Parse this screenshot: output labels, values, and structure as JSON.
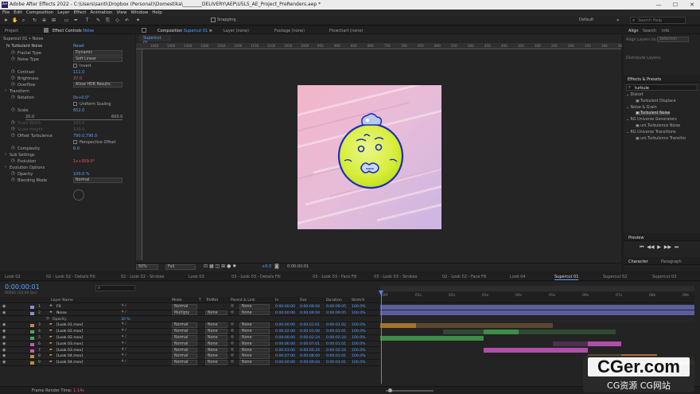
{
  "window": {
    "title": "Adobe After Effects 2022 - C:\\Users\\santi\\Dropbox (Personal)\\Domestika\\________DELIVERY\\AEP\\U5L5_AE_Project_PreRenders.aep *",
    "logo": "Ae",
    "min": "—",
    "max": "☐",
    "close": "✕"
  },
  "menu": [
    "File",
    "Edit",
    "Composition",
    "Layer",
    "Effect",
    "Animation",
    "View",
    "Window",
    "Help"
  ],
  "toolbar": {
    "snapping": "Snapping",
    "workspace": "Default",
    "workspace_more": "»",
    "search_placeholder": "Search Help"
  },
  "project_tab": "Project",
  "effect_controls_tab": "Effect Controls",
  "effect_controls_layer": "Noise",
  "effect_header": "Supercut 01 • Noise",
  "effect": {
    "name": "Turbulent Noise",
    "reset": "Reset",
    "fx": "fx",
    "props": [
      {
        "label": "Fractal Type",
        "value": "Dynamic",
        "kind": "dd"
      },
      {
        "label": "Noise Type",
        "value": "Soft Linear",
        "kind": "dd"
      },
      {
        "label": "",
        "value": "Invert",
        "kind": "cb"
      },
      {
        "label": "Contrast",
        "value": "111.0",
        "kind": "num"
      },
      {
        "label": "Brightness",
        "value": "37.0",
        "kind": "num",
        "red": true
      },
      {
        "label": "Overflow",
        "value": "Allow HDR Results",
        "kind": "dd"
      },
      {
        "label": "Transform",
        "value": "",
        "kind": "group"
      },
      {
        "label": "Rotation",
        "value": "0x+0.0°",
        "kind": "num"
      },
      {
        "label": "",
        "value": "Uniform Scaling",
        "kind": "cb"
      },
      {
        "label": "Scale",
        "value": "652.0",
        "kind": "num"
      },
      {
        "label": "",
        "value": "20.0",
        "kind": "slider",
        "max": "600.0"
      },
      {
        "label": "Scale Width",
        "value": "100.0",
        "kind": "num",
        "dim": true
      },
      {
        "label": "Scale Height",
        "value": "100.0",
        "kind": "num",
        "dim": true
      },
      {
        "label": "Offset Turbulence",
        "value": "790.0,790.0",
        "kind": "num"
      },
      {
        "label": "",
        "value": "Perspective Offset",
        "kind": "cb"
      },
      {
        "label": "Complexity",
        "value": "6.0",
        "kind": "num"
      },
      {
        "label": "Sub Settings",
        "value": "",
        "kind": "group"
      },
      {
        "label": "Evolution",
        "value": "1x+309.0°",
        "kind": "num",
        "red": true
      },
      {
        "label": "Evolution Options",
        "value": "",
        "kind": "group"
      },
      {
        "label": "Opacity",
        "value": "100.0 %",
        "kind": "num"
      },
      {
        "label": "Blending Mode",
        "value": "Normal",
        "kind": "dd"
      }
    ]
  },
  "comp": {
    "tab_prefix": "Composition",
    "tab_name": "Supercut 01",
    "menu_icon": "≡",
    "tab2": "Layer (none)",
    "tab3": "Footage (none)",
    "tab4": "Flowchart (none)",
    "crumb": "Supercut 01",
    "ruler": [
      "1450",
      "1400",
      "1350",
      "1300",
      "1250",
      "1200",
      "1150",
      "1100",
      "1050",
      "1000",
      "950",
      "900",
      "850",
      "800",
      "750",
      "700",
      "650",
      "600",
      "550",
      "500",
      "450",
      "400",
      "350",
      "300",
      "250",
      "200",
      "150",
      "100",
      "50"
    ],
    "zoom": "50%",
    "resolution": "Full",
    "exposure": "+0.0",
    "timecode": "0:00:00:01"
  },
  "right": {
    "align_tab": "Align",
    "search_tab": "Search",
    "info_tab": "Info",
    "align_to": "Align Layers to:",
    "align_to_value": "Selection",
    "distribute": "Distribute Layers:",
    "effects_tab": "Effects & Presets",
    "search_value": "turbule",
    "tree": [
      {
        "text": "Distort",
        "indent": 0
      },
      {
        "text": "Turbulent Displace",
        "indent": 2
      },
      {
        "text": "Noise & Grain",
        "indent": 0
      },
      {
        "text": "Turbulent Noise",
        "indent": 2,
        "sel": true
      },
      {
        "text": "RG Universe Generators",
        "indent": 0
      },
      {
        "text": "uni.Turbulence Noise",
        "indent": 2
      },
      {
        "text": "RG Universe Transitions",
        "indent": 0
      },
      {
        "text": "uni.Turbulence Transitio",
        "indent": 2
      }
    ],
    "preview_tab": "Preview",
    "character_tab": "Character",
    "paragraph_tab": "Paragraph"
  },
  "comp_tabs": [
    "Look 02",
    "02 - Look 02 - Details Fill",
    "02 - Look 02 - Strokes",
    "Look 03",
    "03 - Look 03 - Details Fill",
    "03 - Look 03 - Face Fill",
    "03 - Look 03 - Strokes",
    "02 - Look 02 - Face Fill",
    "Look 04",
    "Supercut 01",
    "Supercut 02",
    "Supercut 03"
  ],
  "timeline": {
    "timecode": "0:00:00:01",
    "frames": "00001 (24.00 fps)",
    "headers": {
      "name": "Layer Name",
      "mode": "Mode",
      "t": "T",
      "trkmat": "TrkMat",
      "parent": "Parent & Link",
      "in": "In",
      "out": "Out",
      "duration": "Duration",
      "stretch": "Stretch"
    },
    "ticks": [
      "00f",
      "01s",
      "02s",
      "03s",
      "04s",
      "05s",
      "06s",
      "07s",
      "08s",
      "09s"
    ],
    "layers": [
      {
        "num": "1",
        "name": "FX",
        "mode": "Normal",
        "trk": "",
        "parent": "None",
        "in": "0:00:00:00",
        "out": "0:00:09:04",
        "dur": "0:00:09:05",
        "str": "100.0%",
        "color": "#8a8fd6",
        "star": true,
        "bar_s": 0,
        "bar_e": 1,
        "bar_c": "#5b5f9e"
      },
      {
        "num": "2",
        "name": "Noise",
        "mode": "Multiply",
        "trk": "None",
        "parent": "None",
        "in": "0:00:00:00",
        "out": "0:00:09:04",
        "dur": "0:00:09:05",
        "str": "100.0%",
        "color": "#8a8fd6",
        "star": true,
        "bar_s": 0,
        "bar_e": 1,
        "bar_c": "#5b5f9e"
      },
      {
        "sub": true,
        "name": "Opacity",
        "value": "30 %"
      },
      {
        "num": "3",
        "name": "[Look 01.mov]",
        "mode": "Normal",
        "trk": "None",
        "parent": "None",
        "in": "0:00:00:00",
        "out": "0:00:01:01",
        "dur": "0:00:01:02",
        "str": "100.0%",
        "color": "#c68a3f",
        "bar_s": 0,
        "bar_e": 0.115,
        "bar_c": "#a5722f",
        "bar2_e": 0.55,
        "bar2_c": "#5a4730"
      },
      {
        "num": "4",
        "name": "[Look 02.mov]",
        "mode": "Normal",
        "trk": "None",
        "parent": "None",
        "in": "0:00:02:00",
        "out": "0:00:03:00",
        "dur": "0:00:01:01",
        "str": "100.0%",
        "color": "#4aaa55",
        "bar_s": 0.328,
        "bar_e": 0.44,
        "bar_c": "#3c8d47",
        "bar2_s": 0.2,
        "bar2_e": 0.75,
        "bar2_c": "#2e4a32"
      },
      {
        "num": "5",
        "name": "[Look 02.mov]",
        "mode": "Normal",
        "trk": "None",
        "parent": "None",
        "in": "0:00:00:00",
        "out": "0:00:02:24",
        "dur": "0:00:02:24",
        "str": "100.0%",
        "color": "#4aaa55",
        "bar_s": 0,
        "bar_e": 0.328,
        "bar_c": "#3c8d47"
      },
      {
        "num": "6",
        "name": "[Look 03.mov]",
        "mode": "Normal",
        "trk": "None",
        "parent": "None",
        "in": "0:00:06:00",
        "out": "0:00:07:01",
        "dur": "0:00:01:01",
        "str": "100.0%",
        "color": "#c35bb9",
        "bar_s": 0.66,
        "bar_e": 0.768,
        "bar_c": "#b04fa7",
        "bar2_s": 0.55,
        "bar2_e": 0.66,
        "bar2_c": "#4d3050"
      },
      {
        "num": "7",
        "name": "[Look 03.mov]",
        "mode": "Normal",
        "trk": "None",
        "parent": "None",
        "in": "0:00:03:00",
        "out": "0:00:05:24",
        "dur": "0:00:02:24",
        "str": "100.0%",
        "color": "#c35bb9",
        "bar_s": 0.328,
        "bar_e": 0.66,
        "bar_c": "#b04fa7"
      },
      {
        "num": "8",
        "name": "[Look 04.mov]",
        "mode": "Normal",
        "trk": "None",
        "parent": "None",
        "in": "0:00:07:00",
        "out": "0:00:08:00",
        "dur": "0:00:01:01",
        "str": "100.0%",
        "color": "#c68a3f",
        "bar_s": 0.768,
        "bar_e": 0.88,
        "bar_c": "#a5722f",
        "bar2_s": 0.66,
        "bar2_e": 0.768,
        "bar2_c": "#5a4730"
      },
      {
        "num": "9",
        "name": "[Look 04.mov]",
        "mode": "Normal",
        "trk": "None",
        "parent": "None",
        "in": "0:00:00:00",
        "out": "0:00:09:04",
        "dur": "0:00:01:01",
        "str": "100.0%",
        "color": "#c68a3f",
        "bar_s": 0.88,
        "bar_e": 1,
        "bar_c": "#a5722f"
      }
    ],
    "footer": "Frame Render Time:",
    "render_time": "1.14s"
  },
  "watermark": {
    "main": "CGer.com",
    "sub": "CG资源 CG网站"
  }
}
